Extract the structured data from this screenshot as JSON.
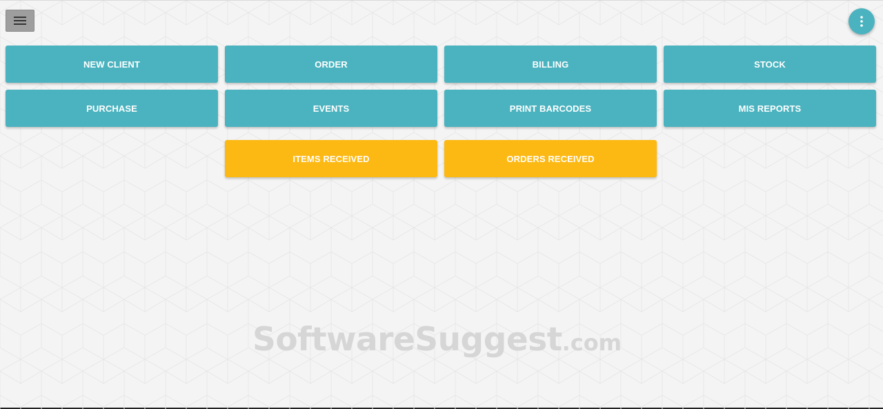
{
  "header": {
    "menu_icon": "hamburger-menu-icon",
    "more_icon": "more-vertical-icon"
  },
  "tiles": {
    "row1": [
      {
        "label": "NEW CLIENT"
      },
      {
        "label": "ORDER"
      },
      {
        "label": "BILLING"
      },
      {
        "label": "STOCK"
      }
    ],
    "row2": [
      {
        "label": "PURCHASE"
      },
      {
        "label": "EVENTS"
      },
      {
        "label": "PRINT BARCODES"
      },
      {
        "label": "MIS REPORTS"
      }
    ],
    "row3": [
      {
        "label": "ITEMS RECEIVED"
      },
      {
        "label": "ORDERS RECEIVED"
      }
    ]
  },
  "watermark": {
    "main": "SoftwareSuggest",
    "suffix": ".com"
  },
  "colors": {
    "primary_tile": "#4bb3bf",
    "accent_tile": "#fdb913",
    "background": "#f4f4f4",
    "menu_button": "#9e9e9e"
  }
}
